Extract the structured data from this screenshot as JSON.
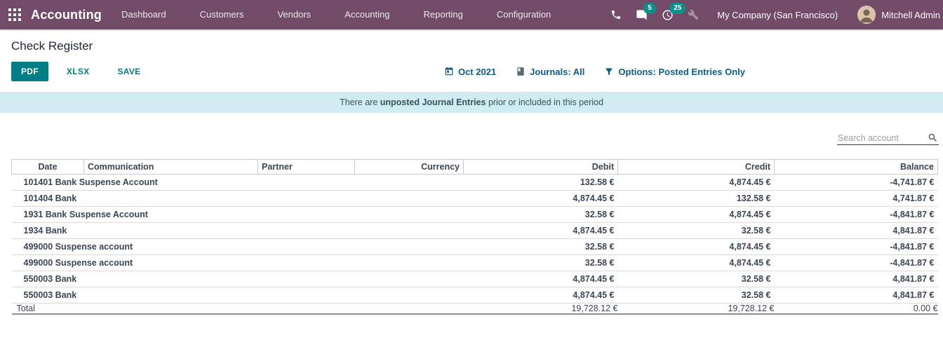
{
  "colors": {
    "navbar": "#714B67",
    "accent": "#017e84",
    "badge": "#0c8e8a",
    "filter_link": "#0d5c84",
    "banner_bg": "#d1ecf1"
  },
  "navbar": {
    "brand": "Accounting",
    "menu": [
      {
        "label": "Dashboard"
      },
      {
        "label": "Customers"
      },
      {
        "label": "Vendors"
      },
      {
        "label": "Accounting"
      },
      {
        "label": "Reporting"
      },
      {
        "label": "Configuration"
      }
    ],
    "messages_badge": "5",
    "activities_badge": "25",
    "company": "My Company (San Francisco)",
    "user": "Mitchell Admin",
    "icons": [
      "apps-grid",
      "phone",
      "messages",
      "activities",
      "tools",
      "avatar"
    ]
  },
  "page": {
    "title": "Check Register"
  },
  "toolbar": {
    "pdf": "PDF",
    "xlsx": "XLSX",
    "save": "SAVE"
  },
  "filters": [
    {
      "icon": "calendar",
      "label": "Oct 2021"
    },
    {
      "icon": "journal-book",
      "label": "Journals: All"
    },
    {
      "icon": "funnel",
      "label": "Options: Posted Entries Only"
    }
  ],
  "banner": {
    "prefix": "There are ",
    "bold": "unposted Journal Entries",
    "suffix": " prior or included in this period"
  },
  "search": {
    "placeholder": "Search account",
    "icon": "magnifier"
  },
  "table": {
    "columns": [
      {
        "label": "Date",
        "align": "center"
      },
      {
        "label": "Communication",
        "align": "left"
      },
      {
        "label": "Partner",
        "align": "left"
      },
      {
        "label": "Currency",
        "align": "right"
      },
      {
        "label": "Debit",
        "align": "right"
      },
      {
        "label": "Credit",
        "align": "right"
      },
      {
        "label": "Balance",
        "align": "right"
      }
    ],
    "rows": [
      {
        "account": "101401 Bank Suspense Account",
        "debit": "132.58 €",
        "credit": "4,874.45 €",
        "balance": "-4,741.87 €"
      },
      {
        "account": "101404 Bank",
        "debit": "4,874.45 €",
        "credit": "132.58 €",
        "balance": "4,741.87 €"
      },
      {
        "account": "1931 Bank Suspense Account",
        "debit": "32.58 €",
        "credit": "4,874.45 €",
        "balance": "-4,841.87 €"
      },
      {
        "account": "1934 Bank",
        "debit": "4,874.45 €",
        "credit": "32.58 €",
        "balance": "4,841.87 €"
      },
      {
        "account": "499000 Suspense account",
        "debit": "32.58 €",
        "credit": "4,874.45 €",
        "balance": "-4,841.87 €"
      },
      {
        "account": "499000 Suspense account",
        "debit": "32.58 €",
        "credit": "4,874.45 €",
        "balance": "-4,841.87 €"
      },
      {
        "account": "550003 Bank",
        "debit": "4,874.45 €",
        "credit": "32.58 €",
        "balance": "4,841.87 €"
      },
      {
        "account": "550003 Bank",
        "debit": "4,874.45 €",
        "credit": "32.58 €",
        "balance": "4,841.87 €"
      }
    ],
    "total": {
      "label": "Total",
      "debit": "19,728.12 €",
      "credit": "19,728.12 €",
      "balance": "0.00 €"
    }
  }
}
